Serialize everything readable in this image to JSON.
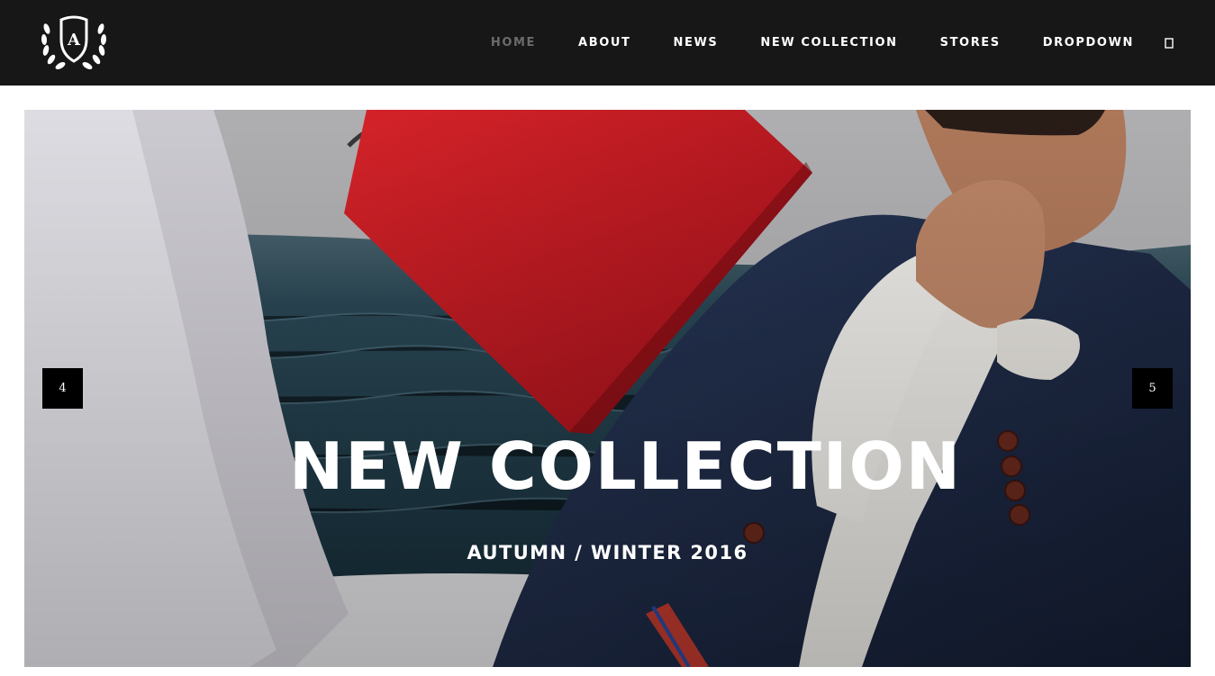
{
  "header": {
    "logo_letter": "A",
    "nav": [
      {
        "label": "HOME",
        "active": true
      },
      {
        "label": "ABOUT"
      },
      {
        "label": "NEWS"
      },
      {
        "label": "NEW COLLECTION"
      },
      {
        "label": "STORES"
      },
      {
        "label": "DROPDOWN"
      }
    ],
    "search_icon": "search-icon"
  },
  "hero": {
    "title": "NEW COLLECTION",
    "subtitle": "AUTUMN / WINTER 2016",
    "prev_label": "4",
    "next_label": "5"
  },
  "colors": {
    "header_bg": "#171717",
    "nav_active": "#6b6b6b",
    "bag_red": "#c4161c",
    "jacket_navy": "#1d2a45"
  }
}
